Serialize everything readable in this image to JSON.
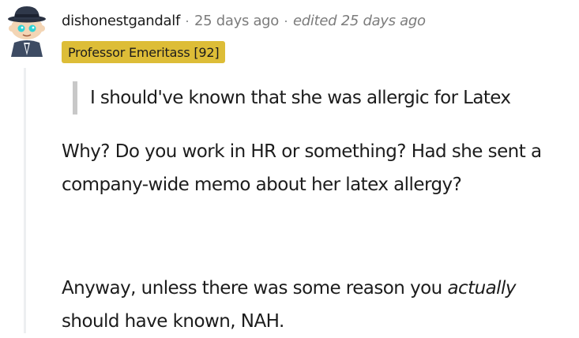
{
  "comment": {
    "username": "dishonestgandalf",
    "separator": "·",
    "time_ago": "25 days ago",
    "edited": "edited 25 days ago",
    "flair": "Professor Emeritass [92]",
    "quote": "I should've known that she was allergic for Latex",
    "paragraph1": "Why? Do you work in HR or something? Had she sent a company-wide memo about her latex allergy?",
    "paragraph2": {
      "before": "Anyway, unless there was some reason you ",
      "emphasis": "actually",
      "after": " should have known, NAH."
    }
  },
  "colors": {
    "flair_background": "#ddbd37",
    "meta_text": "#7c7c7c",
    "quote_bar": "#c8c8c8",
    "thread_line": "#edeff1",
    "body_text": "#1c1c1c"
  },
  "icons": {
    "avatar": "snoo-avatar-fedora"
  }
}
